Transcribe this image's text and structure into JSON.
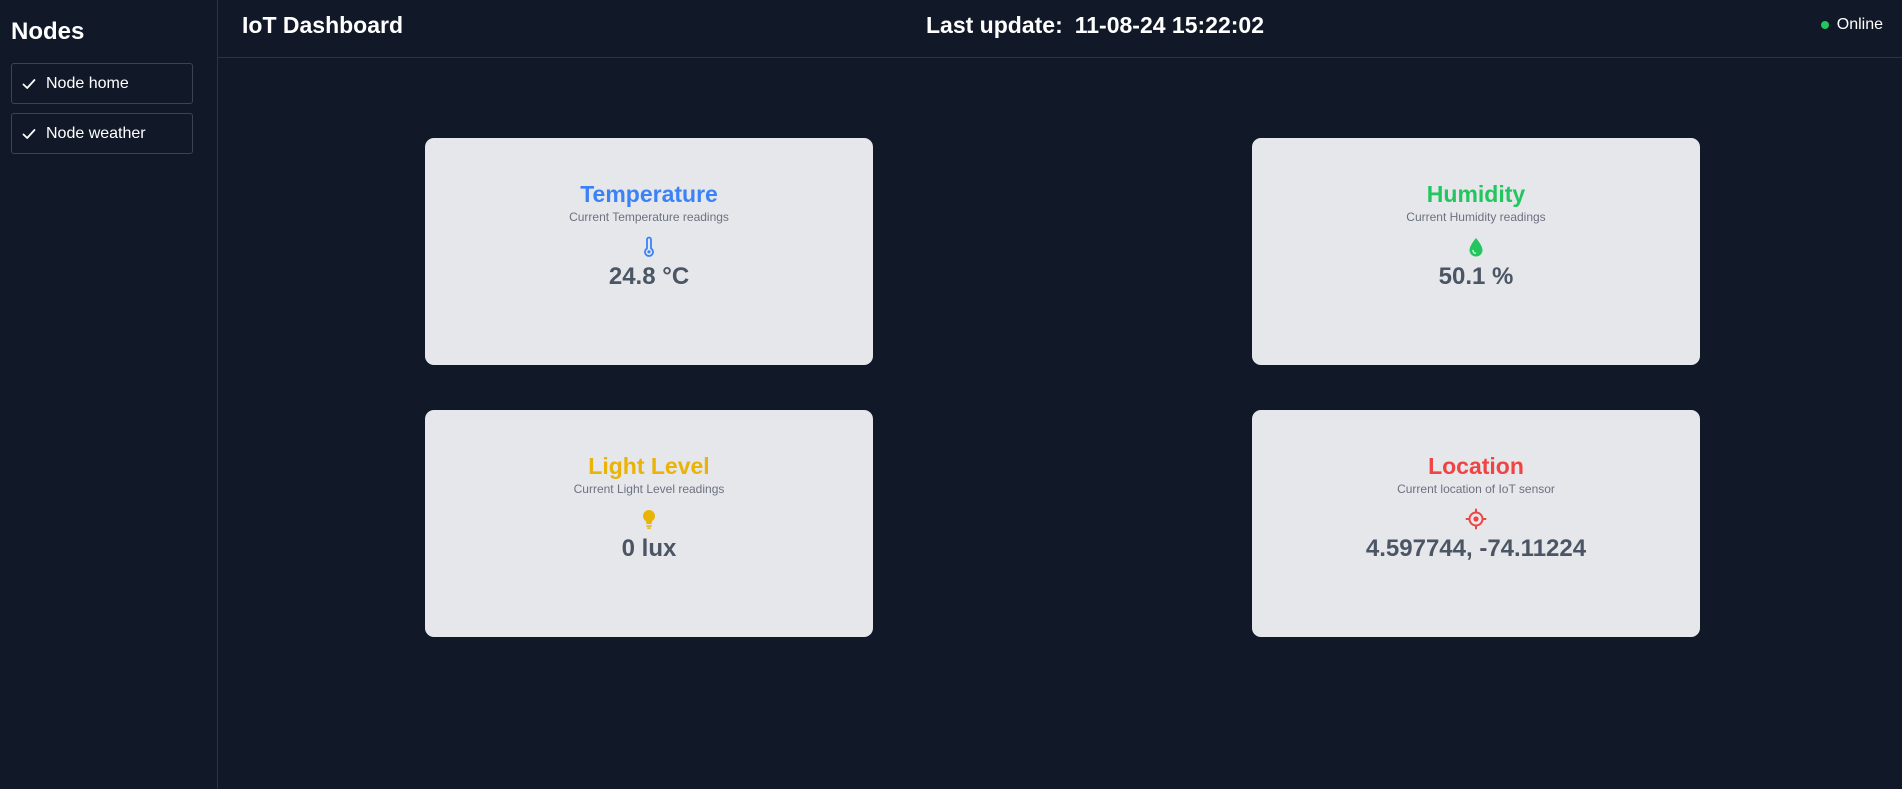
{
  "sidebar": {
    "title": "Nodes",
    "items": [
      {
        "label": "Node home",
        "icon": "check-icon"
      },
      {
        "label": "Node weather",
        "icon": "check-icon"
      }
    ]
  },
  "header": {
    "title": "IoT Dashboard",
    "last_update_label": "Last update:",
    "last_update_value": "11-08-24 15:22:02",
    "status": "Online",
    "status_color": "#22c55e"
  },
  "cards": [
    {
      "title": "Temperature",
      "subtitle": "Current Temperature readings",
      "icon": "thermometer-icon",
      "value": "24.8 °C",
      "color": "#3b82f6"
    },
    {
      "title": "Humidity",
      "subtitle": "Current Humidity readings",
      "icon": "droplet-icon",
      "value": "50.1 %",
      "color": "#22c55e"
    },
    {
      "title": "Light Level",
      "subtitle": "Current Light Level readings",
      "icon": "lightbulb-icon",
      "value": "0 lux",
      "color": "#eab308"
    },
    {
      "title": "Location",
      "subtitle": "Current location of IoT sensor",
      "icon": "crosshair-icon",
      "value": "4.597744, -74.11224",
      "color": "#ef4444"
    }
  ]
}
